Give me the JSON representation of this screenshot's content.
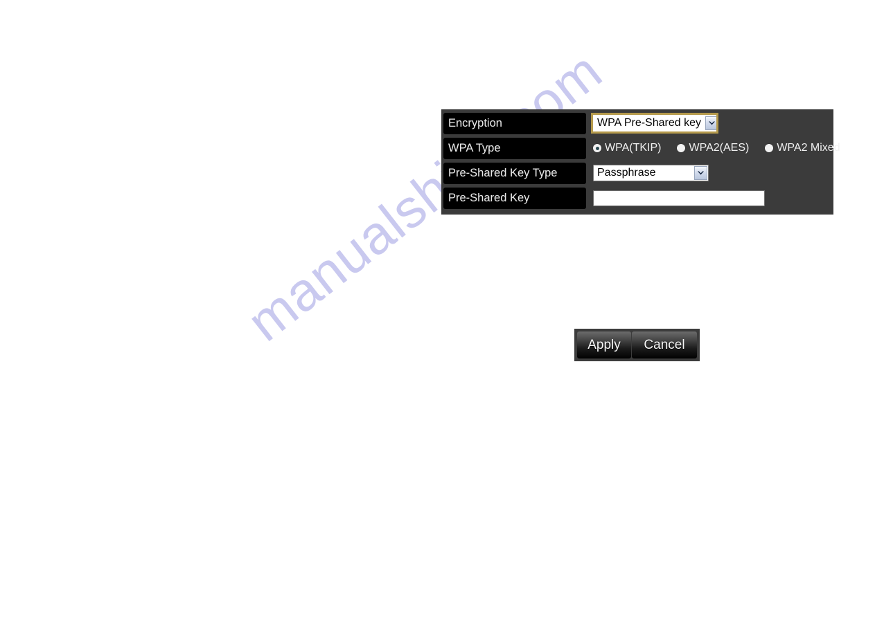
{
  "watermark": {
    "text": "manualshive.com"
  },
  "settings_panel": {
    "rows": [
      {
        "label": "Encryption",
        "control": "select",
        "value": "WPA Pre-Shared key",
        "options": [
          "WPA Pre-Shared key"
        ],
        "focused": true
      },
      {
        "label": "WPA Type",
        "control": "radio-group",
        "options": [
          {
            "label": "WPA(TKIP)",
            "checked": true
          },
          {
            "label": "WPA2(AES)",
            "checked": false
          },
          {
            "label": "WPA2 Mixed",
            "checked": false
          }
        ]
      },
      {
        "label": "Pre-Shared Key Type",
        "control": "select",
        "value": "Passphrase",
        "options": [
          "Passphrase"
        ],
        "focused": false
      },
      {
        "label": "Pre-Shared Key",
        "control": "text",
        "value": "",
        "placeholder": ""
      }
    ]
  },
  "actions": {
    "apply_label": "Apply",
    "cancel_label": "Cancel"
  },
  "colors": {
    "panel_background": "#3b3b3b",
    "label_background": "#000000",
    "label_text": "#e9e9e9",
    "focus_ring": "#b59a4c",
    "watermark": "#c9c9ef",
    "button_text": "#f6f6f6"
  }
}
